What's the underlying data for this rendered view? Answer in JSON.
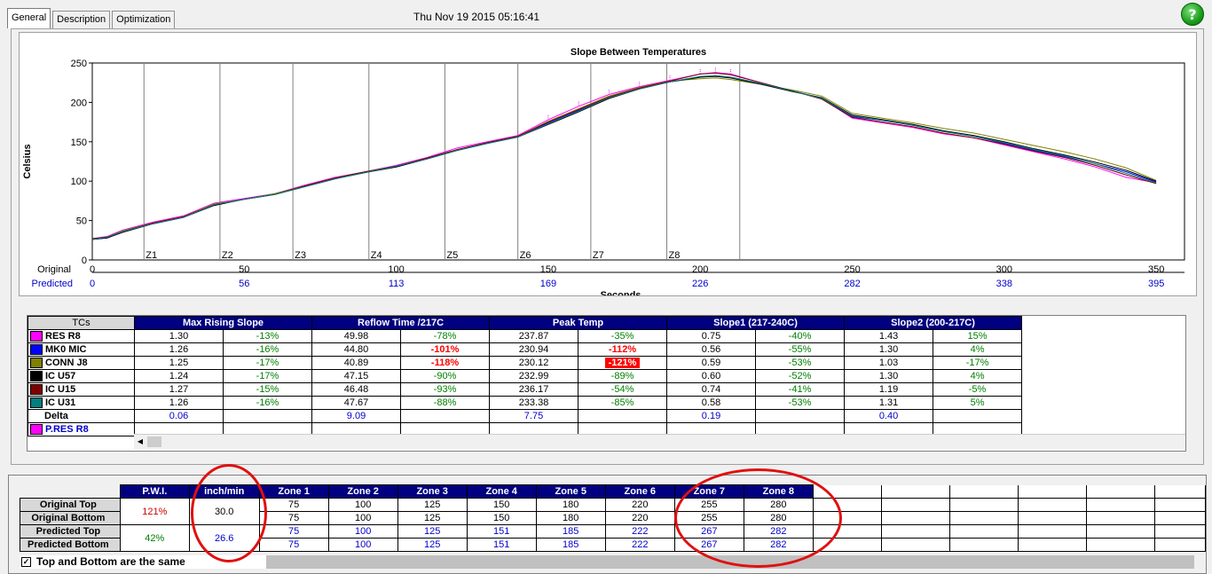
{
  "tabs": [
    "General",
    "Description",
    "Optimization"
  ],
  "datetime": "Thu Nov 19 2015 05:16:41",
  "help_icon": "help-question-icon",
  "chart_data": {
    "type": "line",
    "title": "Slope Between Temperatures",
    "ylabel": "Celsius",
    "xlabel": "Seconds",
    "ylim": [
      0,
      250
    ],
    "yticks": [
      0,
      50,
      100,
      150,
      200,
      250
    ],
    "xlim": [
      0,
      352
    ],
    "x_original_label": "Original",
    "x_predicted_label": "Predicted",
    "x_original_ticks": [
      "0",
      "50",
      "100",
      "150",
      "200",
      "250",
      "300",
      "350"
    ],
    "x_predicted_ticks": [
      "0",
      "56",
      "113",
      "169",
      "226",
      "282",
      "338",
      "395"
    ],
    "zone_labels": [
      "Z1",
      "Z2",
      "Z3",
      "Z4",
      "Z5",
      "Z6",
      "Z7",
      "Z8"
    ],
    "zone_boundaries": [
      17,
      42,
      66,
      91,
      116,
      140,
      164,
      189,
      213
    ],
    "series": [
      {
        "color": "#ff00ff",
        "points": [
          [
            0,
            27
          ],
          [
            5,
            30
          ],
          [
            10,
            38
          ],
          [
            20,
            48
          ],
          [
            30,
            56
          ],
          [
            40,
            72
          ],
          [
            50,
            78
          ],
          [
            60,
            84
          ],
          [
            70,
            95
          ],
          [
            80,
            105
          ],
          [
            90,
            112
          ],
          [
            100,
            120
          ],
          [
            110,
            130
          ],
          [
            120,
            142
          ],
          [
            130,
            150
          ],
          [
            140,
            158
          ],
          [
            150,
            178
          ],
          [
            160,
            195
          ],
          [
            170,
            210
          ],
          [
            180,
            220
          ],
          [
            190,
            228
          ],
          [
            200,
            236
          ],
          [
            205,
            238
          ],
          [
            210,
            236
          ],
          [
            220,
            225
          ],
          [
            230,
            215
          ],
          [
            240,
            205
          ],
          [
            250,
            180
          ],
          [
            260,
            174
          ],
          [
            270,
            168
          ],
          [
            280,
            160
          ],
          [
            290,
            155
          ],
          [
            300,
            146
          ],
          [
            310,
            137
          ],
          [
            320,
            128
          ],
          [
            330,
            118
          ],
          [
            340,
            105
          ],
          [
            350,
            98
          ]
        ]
      },
      {
        "color": "#0000ff",
        "points": [
          [
            0,
            26
          ],
          [
            5,
            28
          ],
          [
            10,
            36
          ],
          [
            20,
            46
          ],
          [
            30,
            54
          ],
          [
            40,
            70
          ],
          [
            50,
            77
          ],
          [
            60,
            84
          ],
          [
            70,
            94
          ],
          [
            80,
            104
          ],
          [
            90,
            112
          ],
          [
            100,
            119
          ],
          [
            110,
            129
          ],
          [
            120,
            140
          ],
          [
            130,
            149
          ],
          [
            140,
            157
          ],
          [
            150,
            174
          ],
          [
            160,
            190
          ],
          [
            170,
            206
          ],
          [
            180,
            218
          ],
          [
            190,
            226
          ],
          [
            200,
            232
          ],
          [
            205,
            234
          ],
          [
            210,
            232
          ],
          [
            220,
            224
          ],
          [
            230,
            215
          ],
          [
            240,
            205
          ],
          [
            250,
            182
          ],
          [
            260,
            177
          ],
          [
            270,
            171
          ],
          [
            280,
            163
          ],
          [
            290,
            157
          ],
          [
            300,
            148
          ],
          [
            310,
            139
          ],
          [
            320,
            131
          ],
          [
            330,
            122
          ],
          [
            340,
            112
          ],
          [
            350,
            99
          ]
        ]
      },
      {
        "color": "#808000",
        "points": [
          [
            0,
            27
          ],
          [
            5,
            29
          ],
          [
            10,
            37
          ],
          [
            20,
            47
          ],
          [
            30,
            55
          ],
          [
            40,
            71
          ],
          [
            50,
            77
          ],
          [
            60,
            84
          ],
          [
            70,
            94
          ],
          [
            80,
            104
          ],
          [
            90,
            112
          ],
          [
            100,
            119
          ],
          [
            110,
            129
          ],
          [
            120,
            140
          ],
          [
            130,
            149
          ],
          [
            140,
            157
          ],
          [
            150,
            176
          ],
          [
            160,
            192
          ],
          [
            170,
            208
          ],
          [
            180,
            219
          ],
          [
            190,
            227
          ],
          [
            200,
            230
          ],
          [
            205,
            231
          ],
          [
            210,
            229
          ],
          [
            220,
            223
          ],
          [
            230,
            216
          ],
          [
            240,
            208
          ],
          [
            250,
            186
          ],
          [
            260,
            180
          ],
          [
            270,
            174
          ],
          [
            280,
            167
          ],
          [
            290,
            161
          ],
          [
            300,
            153
          ],
          [
            310,
            145
          ],
          [
            320,
            137
          ],
          [
            330,
            128
          ],
          [
            340,
            117
          ],
          [
            350,
            101
          ]
        ]
      },
      {
        "color": "#000000",
        "points": [
          [
            0,
            26
          ],
          [
            5,
            28
          ],
          [
            10,
            35
          ],
          [
            20,
            46
          ],
          [
            30,
            54
          ],
          [
            40,
            69
          ],
          [
            50,
            77
          ],
          [
            60,
            83
          ],
          [
            70,
            93
          ],
          [
            80,
            103
          ],
          [
            90,
            111
          ],
          [
            100,
            118
          ],
          [
            110,
            128
          ],
          [
            120,
            139
          ],
          [
            130,
            148
          ],
          [
            140,
            156
          ],
          [
            150,
            172
          ],
          [
            160,
            188
          ],
          [
            170,
            205
          ],
          [
            180,
            217
          ],
          [
            190,
            226
          ],
          [
            200,
            232
          ],
          [
            205,
            233
          ],
          [
            210,
            231
          ],
          [
            220,
            223
          ],
          [
            230,
            214
          ],
          [
            240,
            206
          ],
          [
            250,
            184
          ],
          [
            260,
            178
          ],
          [
            270,
            172
          ],
          [
            280,
            164
          ],
          [
            290,
            158
          ],
          [
            300,
            150
          ],
          [
            310,
            141
          ],
          [
            320,
            133
          ],
          [
            330,
            124
          ],
          [
            340,
            114
          ],
          [
            350,
            100
          ]
        ]
      },
      {
        "color": "#800000",
        "points": [
          [
            0,
            27
          ],
          [
            5,
            29
          ],
          [
            10,
            36
          ],
          [
            20,
            47
          ],
          [
            30,
            55
          ],
          [
            40,
            70
          ],
          [
            50,
            77
          ],
          [
            60,
            83
          ],
          [
            70,
            94
          ],
          [
            80,
            104
          ],
          [
            90,
            112
          ],
          [
            100,
            119
          ],
          [
            110,
            129
          ],
          [
            120,
            140
          ],
          [
            130,
            149
          ],
          [
            140,
            157
          ],
          [
            150,
            175
          ],
          [
            160,
            191
          ],
          [
            170,
            207
          ],
          [
            180,
            218
          ],
          [
            190,
            227
          ],
          [
            200,
            236
          ],
          [
            205,
            237
          ],
          [
            210,
            235
          ],
          [
            220,
            225
          ],
          [
            230,
            215
          ],
          [
            240,
            204
          ],
          [
            250,
            181
          ],
          [
            260,
            175
          ],
          [
            270,
            169
          ],
          [
            280,
            161
          ],
          [
            290,
            155
          ],
          [
            300,
            147
          ],
          [
            310,
            138
          ],
          [
            320,
            130
          ],
          [
            330,
            120
          ],
          [
            340,
            108
          ],
          [
            350,
            97
          ]
        ]
      },
      {
        "color": "#008080",
        "points": [
          [
            0,
            26
          ],
          [
            5,
            29
          ],
          [
            10,
            36
          ],
          [
            20,
            46
          ],
          [
            30,
            54
          ],
          [
            40,
            70
          ],
          [
            50,
            77
          ],
          [
            60,
            83
          ],
          [
            70,
            93
          ],
          [
            80,
            103
          ],
          [
            90,
            111
          ],
          [
            100,
            119
          ],
          [
            110,
            128
          ],
          [
            120,
            139
          ],
          [
            130,
            148
          ],
          [
            140,
            156
          ],
          [
            150,
            173
          ],
          [
            160,
            189
          ],
          [
            170,
            206
          ],
          [
            180,
            217
          ],
          [
            190,
            226
          ],
          [
            200,
            233
          ],
          [
            205,
            234
          ],
          [
            210,
            232
          ],
          [
            220,
            224
          ],
          [
            230,
            215
          ],
          [
            240,
            205
          ],
          [
            250,
            183
          ],
          [
            260,
            177
          ],
          [
            270,
            171
          ],
          [
            280,
            163
          ],
          [
            290,
            157
          ],
          [
            300,
            149
          ],
          [
            310,
            140
          ],
          [
            320,
            132
          ],
          [
            330,
            122
          ],
          [
            340,
            110
          ],
          [
            350,
            98
          ]
        ]
      }
    ]
  },
  "tc_table": {
    "corner": "TCs",
    "groups": [
      "Max Rising Slope",
      "Reflow Time /217C",
      "Peak Temp",
      "Slope1 (217-240C)",
      "Slope2 (200-217C)"
    ],
    "rows": [
      {
        "name": "RES R8",
        "color": "#ff00ff",
        "cells": [
          "1.30",
          "-13%",
          "49.98",
          "-78%",
          "237.87",
          "-35%",
          "0.75",
          "-40%",
          "1.43",
          "15%"
        ],
        "styles": [
          "",
          "pos",
          "",
          "pos",
          "",
          "pos",
          "",
          "pos",
          "",
          "pos"
        ]
      },
      {
        "name": "MK0 MIC",
        "color": "#0000ff",
        "cells": [
          "1.26",
          "-16%",
          "44.80",
          "-101%",
          "230.94",
          "-112%",
          "0.56",
          "-55%",
          "1.30",
          "4%"
        ],
        "styles": [
          "",
          "pos",
          "",
          "negb",
          "",
          "negb",
          "",
          "pos",
          "",
          "pos"
        ]
      },
      {
        "name": "CONN J8",
        "color": "#808000",
        "cells": [
          "1.25",
          "-17%",
          "40.89",
          "-118%",
          "230.12",
          "-121%",
          "0.59",
          "-53%",
          "1.03",
          "-17%"
        ],
        "styles": [
          "",
          "pos",
          "",
          "negb",
          "",
          "redbg",
          "",
          "pos",
          "",
          "pos"
        ]
      },
      {
        "name": "IC U57",
        "color": "#000000",
        "cells": [
          "1.24",
          "-17%",
          "47.15",
          "-90%",
          "232.99",
          "-89%",
          "0.60",
          "-52%",
          "1.30",
          "4%"
        ],
        "styles": [
          "",
          "pos",
          "",
          "pos",
          "",
          "pos",
          "",
          "pos",
          "",
          "pos"
        ]
      },
      {
        "name": "IC U15",
        "color": "#800000",
        "cells": [
          "1.27",
          "-15%",
          "46.48",
          "-93%",
          "236.17",
          "-54%",
          "0.74",
          "-41%",
          "1.19",
          "-5%"
        ],
        "styles": [
          "",
          "pos",
          "",
          "pos",
          "",
          "pos",
          "",
          "pos",
          "",
          "pos"
        ]
      },
      {
        "name": "IC U31",
        "color": "#008080",
        "cells": [
          "1.26",
          "-16%",
          "47.67",
          "-88%",
          "233.38",
          "-85%",
          "0.58",
          "-53%",
          "1.31",
          "5%"
        ],
        "styles": [
          "",
          "pos",
          "",
          "pos",
          "",
          "pos",
          "",
          "pos",
          "",
          "pos"
        ]
      }
    ],
    "delta": {
      "name": "Delta",
      "cells": [
        "0.06",
        "",
        "9.09",
        "",
        "7.75",
        "",
        "0.19",
        "",
        "0.40",
        ""
      ]
    },
    "predicted_row": {
      "name": "P.RES R8",
      "color": "#ff00ff"
    }
  },
  "zone_table": {
    "headers": [
      "P.W.I.",
      "inch/min",
      "Zone 1",
      "Zone 2",
      "Zone 3",
      "Zone 4",
      "Zone 5",
      "Zone 6",
      "Zone 7",
      "Zone 8"
    ],
    "row_labels": [
      "Original Top",
      "Original Bottom",
      "Predicted Top",
      "Predicted Bottom"
    ],
    "pwi_original": "121%",
    "pwi_predicted": "42%",
    "speed_original": "30.0",
    "speed_predicted": "26.6",
    "original_top": [
      "75",
      "100",
      "125",
      "150",
      "180",
      "220",
      "255",
      "280"
    ],
    "original_bottom": [
      "75",
      "100",
      "125",
      "150",
      "180",
      "220",
      "255",
      "280"
    ],
    "predicted_top": [
      "75",
      "100",
      "125",
      "151",
      "185",
      "222",
      "267",
      "282"
    ],
    "predicted_bottom": [
      "75",
      "100",
      "125",
      "151",
      "185",
      "222",
      "267",
      "282"
    ]
  },
  "checkbox": {
    "label": "Top and Bottom are the same",
    "checked": true
  }
}
